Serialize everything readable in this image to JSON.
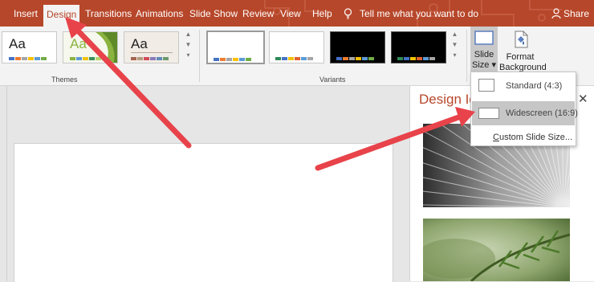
{
  "tabs": [
    {
      "label": "Insert",
      "active": false
    },
    {
      "label": "Design",
      "active": true
    },
    {
      "label": "Transitions",
      "active": false
    },
    {
      "label": "Animations",
      "active": false
    },
    {
      "label": "Slide Show",
      "active": false
    },
    {
      "label": "Review",
      "active": false
    },
    {
      "label": "View",
      "active": false
    },
    {
      "label": "Help",
      "active": false
    }
  ],
  "tell_me": {
    "text": "Tell me what you want to do",
    "icon": "lightbulb-icon"
  },
  "share": {
    "label": "Share",
    "icon": "person-icon"
  },
  "themes": {
    "group_label": "Themes",
    "items": [
      {
        "sample": "Aa",
        "swatches": [
          "#4472c4",
          "#ed7d31",
          "#a5a5a5",
          "#ffc000",
          "#5b9bd5",
          "#70ad47"
        ]
      },
      {
        "sample": "Aa",
        "swatches": [
          "#8ab33f",
          "#5b9bd5",
          "#f2c200",
          "#3d8f5a",
          "#b6d36f",
          "#2e75b6"
        ]
      },
      {
        "sample": "Aa",
        "swatches": [
          "#a5644e",
          "#b19c7d",
          "#d1495b",
          "#8b7ab8",
          "#5b8bb5",
          "#6c9a6c"
        ]
      }
    ]
  },
  "variants": {
    "group_label": "Variants",
    "items": [
      {
        "background": "#ffffff",
        "swatches": [
          "#4472c4",
          "#ed7d31",
          "#a5a5a5",
          "#ffc000",
          "#5b9bd5",
          "#70ad47"
        ]
      },
      {
        "background": "#ffffff",
        "swatches": [
          "#2e8b57",
          "#4472c4",
          "#f2c200",
          "#e06030",
          "#5b9bd5",
          "#a5a5a5"
        ]
      },
      {
        "background": "#000000",
        "swatches": [
          "#4472c4",
          "#ed7d31",
          "#a5a5a5",
          "#ffc000",
          "#5b9bd5",
          "#70ad47"
        ]
      },
      {
        "background": "#000000",
        "swatches": [
          "#2e8b57",
          "#4472c4",
          "#f2c200",
          "#e06030",
          "#5b9bd5",
          "#a5a5a5"
        ]
      }
    ]
  },
  "slide_size": {
    "line1": "Slide",
    "line2": "Size"
  },
  "format_background": {
    "line1": "Format",
    "line2": "Background"
  },
  "dropdown": {
    "standard": "Standard (4:3)",
    "widescreen": "Widescreen (16:9)",
    "custom_prefix": "C",
    "custom_rest": "ustom Slide Size..."
  },
  "design_ideas": {
    "title": "Design Ideas",
    "close_icon": "✕"
  },
  "colors": {
    "accent": "#b7472a",
    "ribbon": "#f3f3f3",
    "arrow": "#e8434a"
  }
}
